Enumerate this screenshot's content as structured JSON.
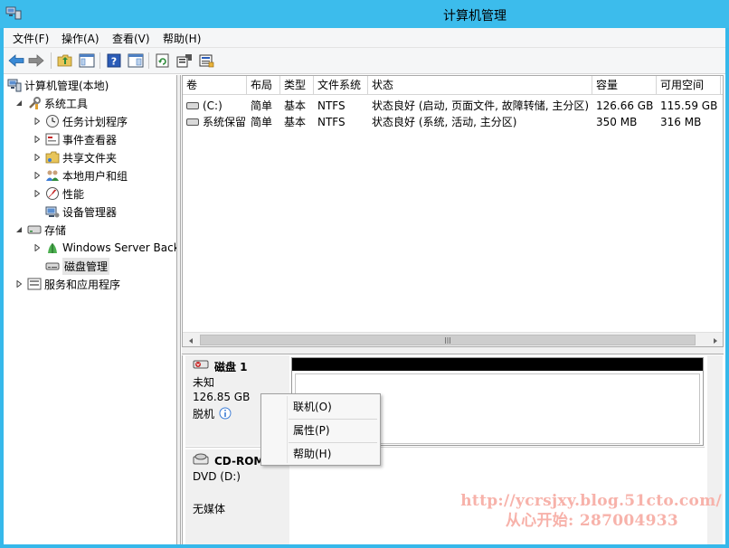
{
  "window": {
    "title": "计算机管理",
    "accent": "#36b8ea"
  },
  "menu": [
    {
      "label": "文件(F)"
    },
    {
      "label": "操作(A)"
    },
    {
      "label": "查看(V)"
    },
    {
      "label": "帮助(H)"
    }
  ],
  "toolbar": {
    "icons": [
      "back-arrow-icon",
      "forward-arrow-icon",
      "up-folder-icon",
      "show-hide-console-tree-icon",
      "help-icon",
      "action-pane-icon",
      "refresh-icon",
      "properties-icon",
      "export-list-icon"
    ]
  },
  "tree": {
    "root": "计算机管理(本地)",
    "system_tools": "系统工具",
    "task_scheduler": "任务计划程序",
    "event_viewer": "事件查看器",
    "shared_folders": "共享文件夹",
    "local_users": "本地用户和组",
    "performance": "性能",
    "device_manager": "设备管理器",
    "storage": "存储",
    "windows_backup": "Windows Server Back",
    "disk_management": "磁盘管理",
    "services_apps": "服务和应用程序"
  },
  "volumes": {
    "columns": [
      "卷",
      "布局",
      "类型",
      "文件系统",
      "状态",
      "容量",
      "可用空间"
    ],
    "rows": [
      {
        "name": "(C:)",
        "layout": "简单",
        "type": "基本",
        "fs": "NTFS",
        "status": "状态良好 (启动, 页面文件, 故障转储, 主分区)",
        "capacity": "126.66 GB",
        "free": "115.59 GB"
      },
      {
        "name": "系统保留",
        "layout": "简单",
        "type": "基本",
        "fs": "NTFS",
        "status": "状态良好 (系统, 活动, 主分区)",
        "capacity": "350 MB",
        "free": "316 MB"
      }
    ]
  },
  "disks": [
    {
      "name": "磁盘 1",
      "kind": "未知",
      "size": "126.85 GB",
      "state": "脱机"
    },
    {
      "name": "CD-ROM 0",
      "kind": "DVD (D:)",
      "state": "无媒体"
    }
  ],
  "context_menu": {
    "items": [
      "联机(O)",
      "属性(P)",
      "帮助(H)"
    ]
  },
  "watermark": {
    "line1": "http://ycrsjxy.blog.51cto.com/",
    "line2": "从心开始: 287004933"
  }
}
